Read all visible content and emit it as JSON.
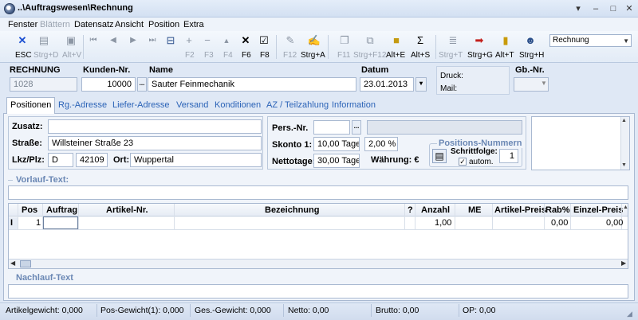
{
  "window": {
    "title": "..\\Auftragswesen\\Rechnung",
    "controls": [
      "▾",
      "–",
      "□",
      "✕"
    ]
  },
  "menu": [
    {
      "label": "Fenster",
      "enabled": true
    },
    {
      "label": "Blättern",
      "enabled": false
    },
    {
      "label": "Datensatz",
      "enabled": true
    },
    {
      "label": "Ansicht",
      "enabled": true
    },
    {
      "label": "Position",
      "enabled": true
    },
    {
      "label": "Extra",
      "enabled": true
    }
  ],
  "toolbar": {
    "labels": [
      "ESC",
      "Strg+D",
      "Alt+V",
      "F2",
      "F3",
      "F4",
      "F6",
      "F8",
      "F12",
      "Strg+A",
      "F11",
      "Strg+F12",
      "Alt+E",
      "Alt+S",
      "Strg+T",
      "Strg+G",
      "Alt+T",
      "Strg+H"
    ],
    "icons": [
      "close-x-icon",
      "print-icon",
      "monitor-icon",
      "first-icon",
      "prev-icon",
      "next-icon",
      "last-icon",
      "split-icon",
      "plus-icon",
      "minus-icon",
      "up-icon",
      "x-icon",
      "check-icon",
      "stamp-icon",
      "sign-icon",
      "copy-icon",
      "tree-icon",
      "box-icon",
      "sum-icon",
      "list-icon",
      "forward-icon",
      "book-icon",
      "person-icon"
    ],
    "mode_select": "Rechnung"
  },
  "header": {
    "rechnung_label": "RECHNUNG",
    "rechnung_value": "1028",
    "kunden_label": "Kunden-Nr.",
    "kunden_value": "10000",
    "name_label": "Name",
    "name_value": "Sauter Feinmechanik",
    "datum_label": "Datum",
    "datum_value": "23.01.2013",
    "druck_label": "Druck:",
    "mail_label": "Mail:",
    "gb_label": "Gb.-Nr.",
    "more": "..."
  },
  "tabs": [
    "Positionen",
    "Rg.-Adresse",
    "Liefer-Adresse",
    "Versand",
    "Konditionen",
    "AZ / Teilzahlung",
    "Information"
  ],
  "address": {
    "zusatz_label": "Zusatz:",
    "zusatz_value": "",
    "strasse_label": "Straße:",
    "strasse_value": "Willsteiner Straße 23",
    "lkz_label": "Lkz/Plz:",
    "lkz_value": "D",
    "plz_value": "42109",
    "ort_label": "Ort:",
    "ort_value": "Wuppertal"
  },
  "terms": {
    "pers_label": "Pers.-Nr.",
    "skonto_label": "Skonto 1:",
    "skonto_days": "10,00 Tage",
    "skonto_pct": "2,00 %",
    "netto_label": "Nettotage:",
    "netto_days": "30,00 Tage",
    "waehrung_label": "Währung: €"
  },
  "positions_numbers": {
    "title": "Positions-Nummern",
    "schritt_label": "Schrittfolge:",
    "schritt_value": "1",
    "autom_label": "autom."
  },
  "vorlauf_label": "Vorlauf-Text:",
  "nachlauf_label": "Nachlauf-Text",
  "grid": {
    "columns": [
      "Pos",
      "Auftrag",
      "Artikel-Nr.",
      "Bezeichnung",
      "?",
      "Anzahl",
      "ME",
      "Artikel-Preis",
      "Rab%",
      "Einzel-Preis"
    ],
    "row": {
      "marker": "I",
      "pos": "1",
      "auftrag": "",
      "artikel": "",
      "bezeichnung": "",
      "q": "",
      "anzahl": "1,00",
      "me": "",
      "preis": "",
      "rab": "0,00",
      "einzel": "0,00"
    }
  },
  "status": [
    {
      "label": "Artikelgewicht: 0,000"
    },
    {
      "label": "Pos-Gewicht(1): 0,000"
    },
    {
      "label": "Ges.-Gewicht: 0,000"
    },
    {
      "label": "Netto: 0,00"
    },
    {
      "label": "Brutto: 0,00"
    },
    {
      "label": "OP: 0,00"
    }
  ]
}
